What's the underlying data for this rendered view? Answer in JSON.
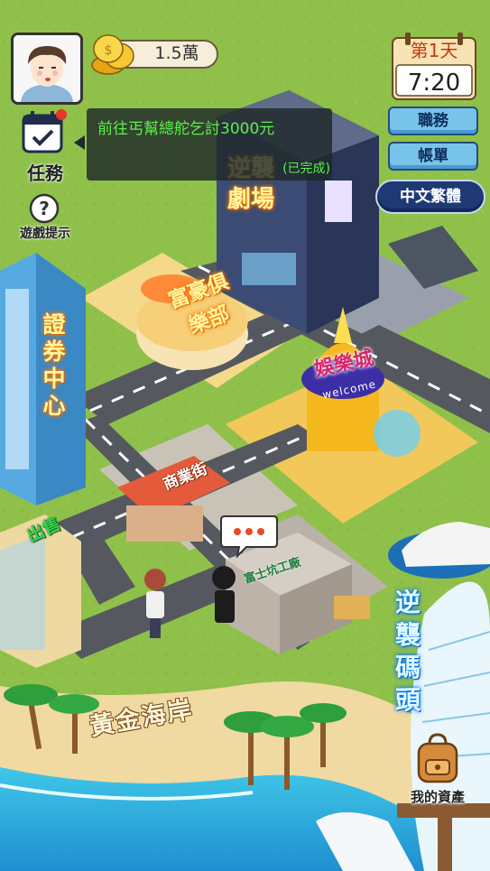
{
  "player": {
    "money": "1.5萬"
  },
  "calendar": {
    "day": "第1天",
    "time": "7:20"
  },
  "menu": {
    "job": "職務",
    "bill": "帳單",
    "language": "中文繁體"
  },
  "task": {
    "icon_label": "任務",
    "text": "前往丐幫總舵乞討3000元",
    "status": "(已完成)"
  },
  "hint": {
    "label": "遊戲提示"
  },
  "assets": {
    "label": "我的資產"
  },
  "map": {
    "theater": "逆襲劇場",
    "club": "富豪俱樂部",
    "entertainment": "娛樂城",
    "entertainment_sub": "welcome",
    "stock_center": "證券中心",
    "commerce": "商業街",
    "factory": "富士坑工廠",
    "for_sale": "出售",
    "coast": "黃金海岸",
    "pier": "逆襲碼頭"
  },
  "icons": {
    "task": "calendar-check-icon",
    "hint": "question-mark-icon",
    "coins": "coin-stack-icon",
    "avatar": "player-avatar"
  }
}
